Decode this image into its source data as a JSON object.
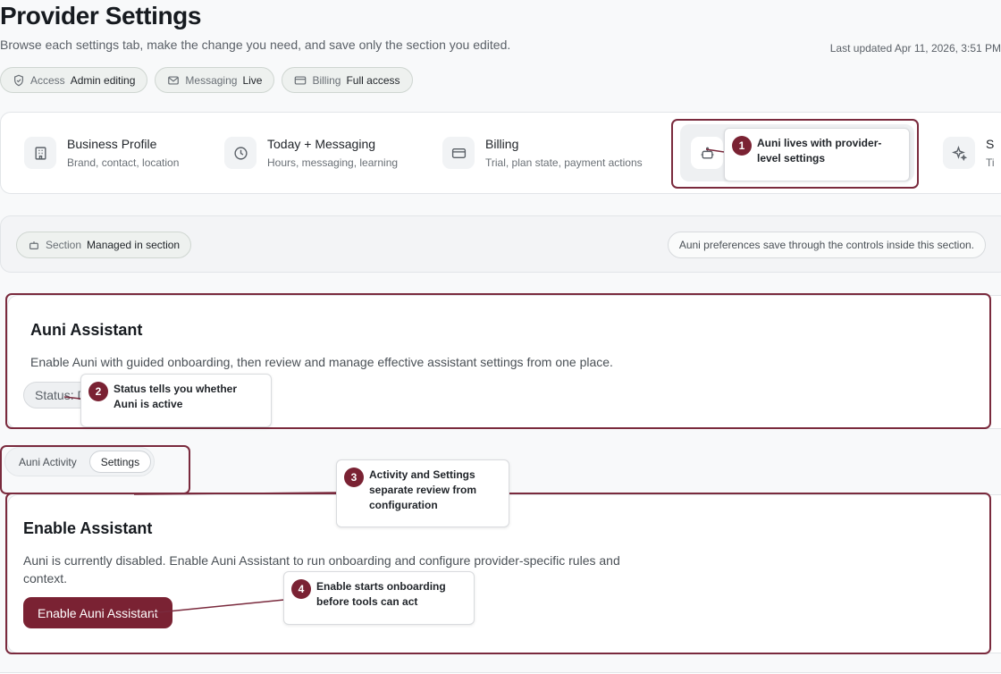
{
  "header": {
    "title": "Provider Settings",
    "subtitle": "Browse each settings tab, make the change you need, and save only the section you edited.",
    "last_updated": "Last updated Apr 11, 2026, 3:51 PM"
  },
  "status_chips": [
    {
      "icon": "shield-icon",
      "label": "Access",
      "value": "Admin editing"
    },
    {
      "icon": "mail-icon",
      "label": "Messaging",
      "value": "Live"
    },
    {
      "icon": "credit-card-icon",
      "label": "Billing",
      "value": "Full access"
    }
  ],
  "tabs": [
    {
      "icon": "building-icon",
      "title": "Business Profile",
      "subtitle": "Brand, contact, location"
    },
    {
      "icon": "clock-icon",
      "title": "Today + Messaging",
      "subtitle": "Hours, messaging, learning"
    },
    {
      "icon": "credit-card-icon",
      "title": "Billing",
      "subtitle": "Trial, plan state, payment actions"
    },
    {
      "icon": "robot-icon",
      "title": "",
      "subtitle": "",
      "active": true
    },
    {
      "icon": "sparkles-icon",
      "title": "S",
      "subtitle": "Ti"
    }
  ],
  "section_bar": {
    "label": "Section",
    "value": "Managed in section",
    "note": "Auni preferences save through the controls inside this section."
  },
  "assistant_card": {
    "title": "Auni Assistant",
    "description": "Enable Auni with guided onboarding, then review and manage effective assistant settings from one place.",
    "status": "Status: D"
  },
  "view_toggle": {
    "options": [
      "Auni Activity",
      "Settings"
    ],
    "selected": "Settings"
  },
  "enable_card": {
    "title": "Enable Assistant",
    "description": "Auni is currently disabled. Enable Auni Assistant to run onboarding and configure provider-specific rules and context.",
    "button": "Enable Auni Assistant"
  },
  "callouts": [
    {
      "num": "1",
      "text": "Auni lives with provider-level settings"
    },
    {
      "num": "2",
      "text": "Status tells you whether Auni is active"
    },
    {
      "num": "3",
      "text": "Activity and Settings separate review from configuration"
    },
    {
      "num": "4",
      "text": "Enable starts onboarding before tools can act"
    }
  ],
  "colors": {
    "accent": "#7a2233",
    "highlight_border": "#7a2a3d",
    "page_bg": "#f8f9fa"
  }
}
